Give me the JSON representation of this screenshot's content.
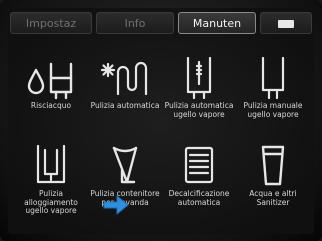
{
  "tabs": [
    {
      "label": "Impostaz"
    },
    {
      "label": "Info"
    },
    {
      "label": "Manuten"
    },
    {
      "label": ""
    }
  ],
  "functions": [
    {
      "label": "Risciacquo",
      "icon": "rinse-icon"
    },
    {
      "label": "Pulizia automatica",
      "icon": "auto-clean-icon"
    },
    {
      "label": "Pulizia automatica ugello vapore",
      "icon": "auto-clean-steam-nozzle-icon"
    },
    {
      "label": "Pulizia manuale ugello vapore",
      "icon": "manual-clean-steam-nozzle-icon"
    },
    {
      "label": "Pulizia alloggiamento ugello vapore",
      "icon": "steam-nozzle-housing-icon"
    },
    {
      "label": "Pulizia contenitore per bevanda",
      "icon": "drink-container-icon"
    },
    {
      "label": "Decalcificazione automatica",
      "icon": "descaling-icon"
    },
    {
      "label": "Acqua e altri Sanitizer",
      "icon": "water-glass-icon"
    }
  ],
  "colors": {
    "accent_arrow": "#2f8fdc",
    "icon_stroke": "#e6e6e6"
  }
}
